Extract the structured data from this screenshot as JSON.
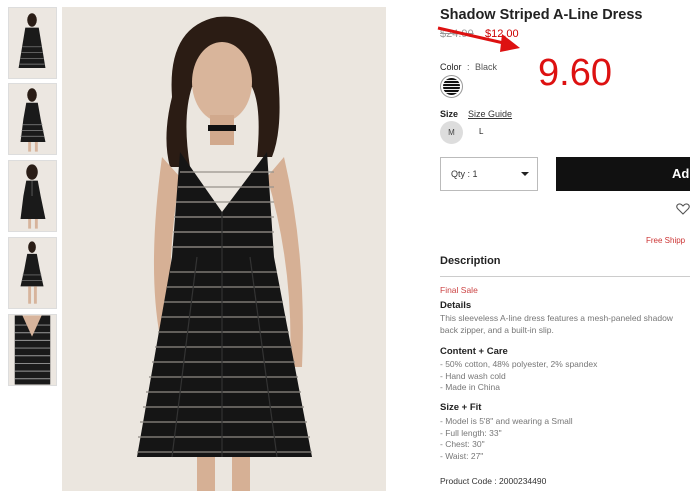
{
  "product": {
    "title": "Shadow Striped A-Line Dress",
    "price_old": "$24.90",
    "price_new": "$12.00",
    "annotation_price": "9.60",
    "color_label": "Color",
    "color_sep": ":",
    "color_value": "Black",
    "size_label": "Size",
    "size_guide": "Size Guide",
    "sizes": [
      "M",
      "L"
    ],
    "qty_label": "Qty : 1",
    "add_label": "Ad",
    "free_shipping": "Free Shipp",
    "description_heading": "Description",
    "final_sale": "Final Sale",
    "details_heading": "Details",
    "details_lines": [
      "This sleeveless A-line dress features a mesh-paneled shadow",
      "back zipper, and a built-in slip."
    ],
    "content_heading": "Content + Care",
    "content_lines": [
      "- 50% cotton, 48% polyester, 2% spandex",
      "- Hand wash cold",
      "- Made in China"
    ],
    "size_fit_heading": "Size + Fit",
    "size_fit_lines": [
      "- Model is 5'8\" and wearing a Small",
      "- Full length: 33\"",
      "- Chest: 30\"",
      "- Waist: 27\""
    ],
    "product_code": "Product Code : 2000234490"
  },
  "colors": {
    "annotation_red": "#dd1111",
    "sale_red": "#cc0000",
    "button_black": "#111111"
  }
}
